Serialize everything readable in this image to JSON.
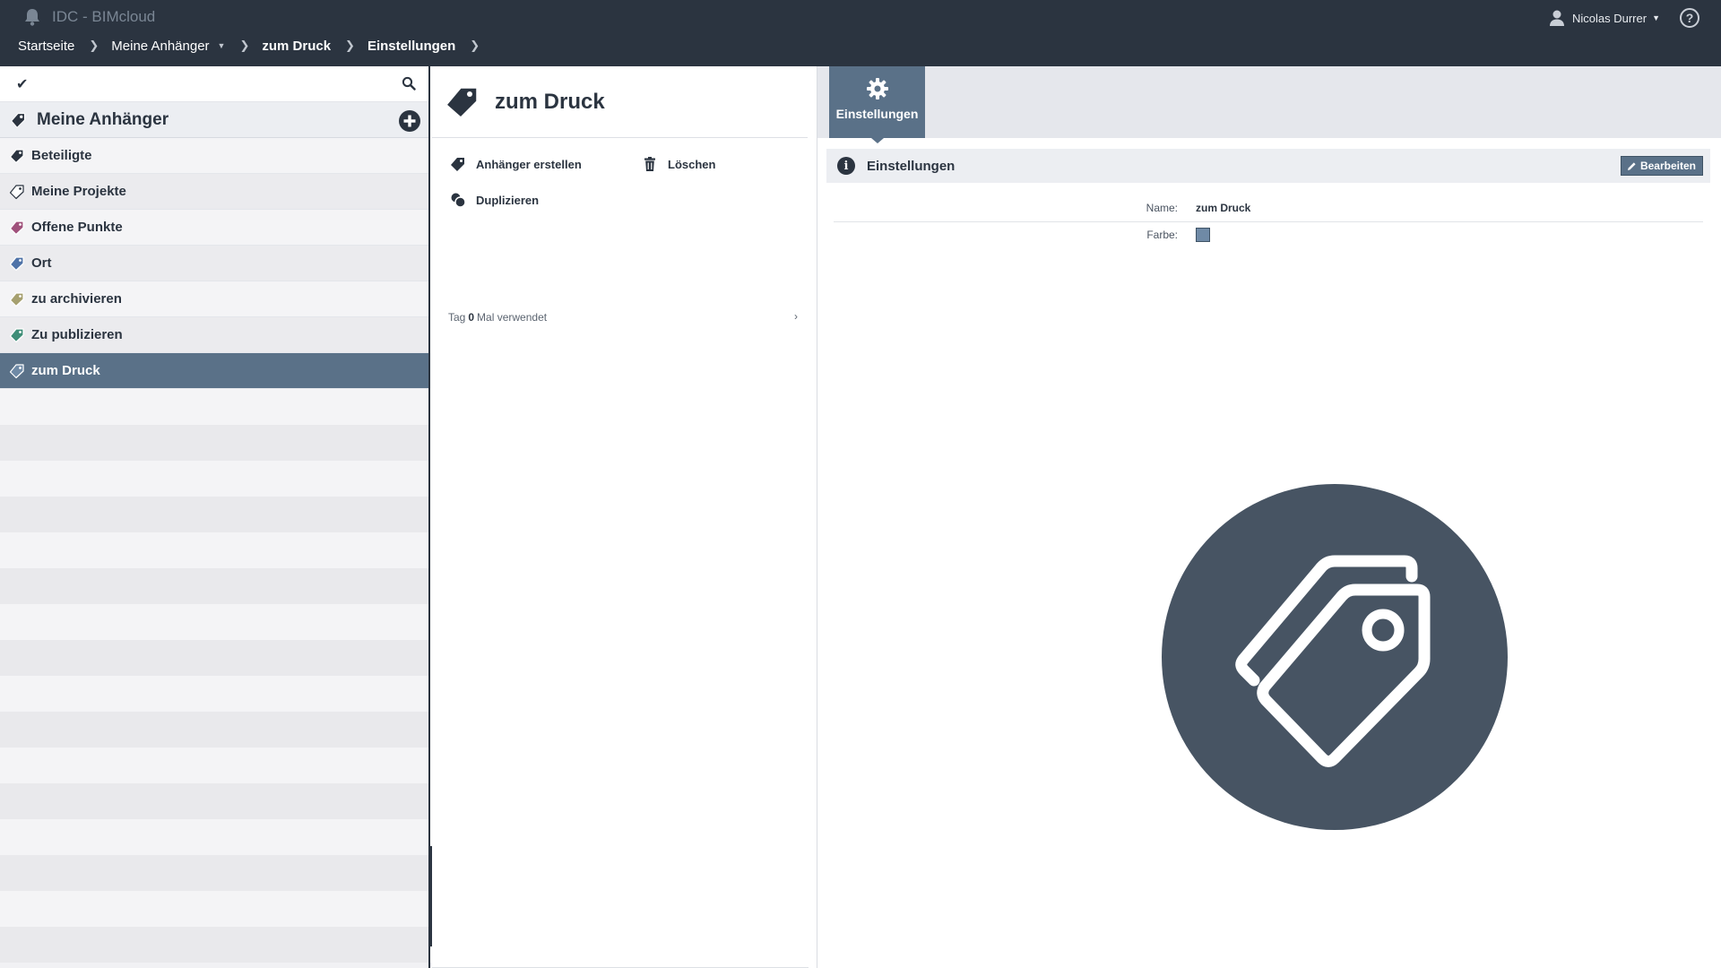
{
  "app": {
    "title": "IDC - BIMcloud"
  },
  "user": {
    "name": "Nicolas Durrer"
  },
  "breadcrumb": {
    "home": "Startseite",
    "my_tags": "Meine Anhänger",
    "current": "zum Druck",
    "section": "Einstellungen"
  },
  "sidebar": {
    "title": "Meine Anhänger",
    "items": [
      {
        "label": "Beteiligte",
        "color": "#2b3440"
      },
      {
        "label": "Meine Projekte",
        "color": "#ffffff"
      },
      {
        "label": "Offene Punkte",
        "color": "#a0527c"
      },
      {
        "label": "Ort",
        "color": "#4f73a8"
      },
      {
        "label": "zu archivieren",
        "color": "#a6a070"
      },
      {
        "label": "Zu publizieren",
        "color": "#3f8e78"
      },
      {
        "label": "zum Druck",
        "color": "#6f8aa6",
        "selected": true
      }
    ]
  },
  "detail": {
    "title": "zum Druck",
    "actions": {
      "create": "Anhänger erstellen",
      "delete": "Löschen",
      "duplicate": "Duplizieren"
    },
    "usage": {
      "prefix": "Tag",
      "count": "0",
      "suffix": "Mal verwendet"
    }
  },
  "settings": {
    "tab_label": "Einstellungen",
    "section_title": "Einstellungen",
    "edit_label": "Bearbeiten",
    "name_label": "Name:",
    "name_value": "zum Druck",
    "color_label": "Farbe:",
    "color_value": "#6f8aa6"
  },
  "icons": {
    "bell": "bell-icon",
    "user": "user-icon",
    "help": "help-icon",
    "check": "check-icon",
    "search": "search-icon",
    "add": "add-icon",
    "tag": "tag-icon",
    "trash": "trash-icon",
    "duplicate": "duplicate-icon",
    "gear": "gear-icon",
    "info": "info-icon",
    "pencil": "pencil-icon"
  }
}
